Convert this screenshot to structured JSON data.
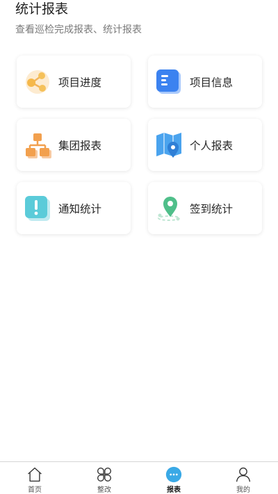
{
  "header": {
    "title": "统计报表",
    "subtitle": "查看巡检完成报表、统计报表"
  },
  "cards": [
    {
      "label": "项目进度",
      "icon": "progress-share-icon"
    },
    {
      "label": "项目信息",
      "icon": "document-info-icon"
    },
    {
      "label": "集团报表",
      "icon": "org-chart-icon"
    },
    {
      "label": "个人报表",
      "icon": "map-pin-icon"
    },
    {
      "label": "通知统计",
      "icon": "notice-exclamation-icon"
    },
    {
      "label": "签到统计",
      "icon": "checkin-location-icon"
    }
  ],
  "tabbar": {
    "items": [
      {
        "label": "首页",
        "icon": "home-icon",
        "active": false
      },
      {
        "label": "整改",
        "icon": "clover-icon",
        "active": false
      },
      {
        "label": "报表",
        "icon": "chat-dots-icon",
        "active": true
      },
      {
        "label": "我的",
        "icon": "user-icon",
        "active": false
      }
    ]
  },
  "colors": {
    "accent": "#3aa9e6",
    "orange": "#f2a04e",
    "blue": "#3b82f0",
    "teal": "#5bcbd9",
    "green": "#4fbf8a"
  }
}
